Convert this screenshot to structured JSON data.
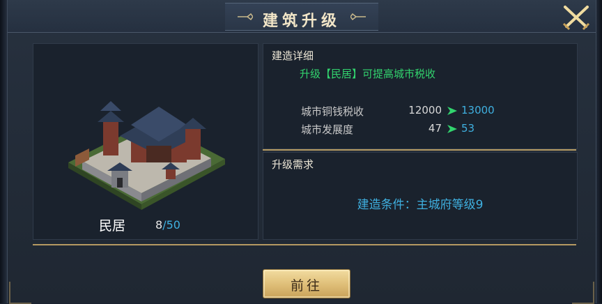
{
  "dialog": {
    "title": "建筑升级",
    "close_icon": "crossed-swords-close-icon"
  },
  "building": {
    "name": "民居",
    "count": "8",
    "separator": "/",
    "max": "50",
    "image_icon": "residence-building-icon"
  },
  "details": {
    "title": "建造详细",
    "description": "升级【民居】可提高城市税收",
    "stats": [
      {
        "label": "城市铜钱税收",
        "old": "12000",
        "new": "13000"
      },
      {
        "label": "城市发展度",
        "old": "47",
        "new": "53"
      }
    ]
  },
  "requirements": {
    "title": "升级需求",
    "text": "建造条件：主城府等级9"
  },
  "action": {
    "label": "前往"
  },
  "colors": {
    "accent_gold": "#b59a62",
    "increase_green": "#32d46e",
    "value_blue": "#3fb0e0",
    "panel_bg": "#1a222d"
  }
}
